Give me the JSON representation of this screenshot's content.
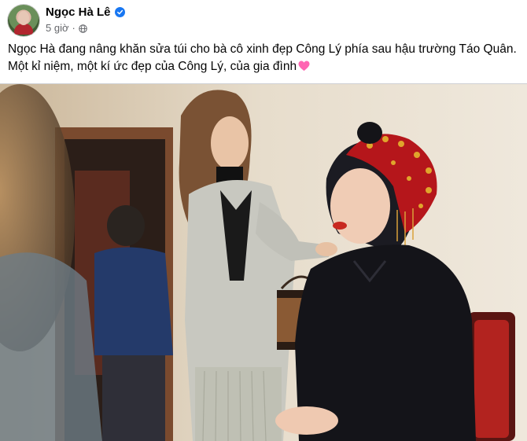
{
  "post": {
    "author": "Ngọc Hà Lê",
    "time": "5 giờ",
    "separator": "·",
    "caption_line1": "Ngọc Hà đang nâng khăn sửa túi cho bà cô xinh đẹp Công Lý phía sau hậu trường Táo Quân.",
    "caption_line2": "Một kỉ niệm, một kí ức đẹp của Công Lý, của gia đình",
    "icons": [
      "verified-badge-icon",
      "globe-icon",
      "pink-heart-icon"
    ]
  },
  "colors": {
    "verified": "#1877f2",
    "meta_text": "#65676b",
    "heart": "#ff66b3",
    "text": "#050505"
  }
}
